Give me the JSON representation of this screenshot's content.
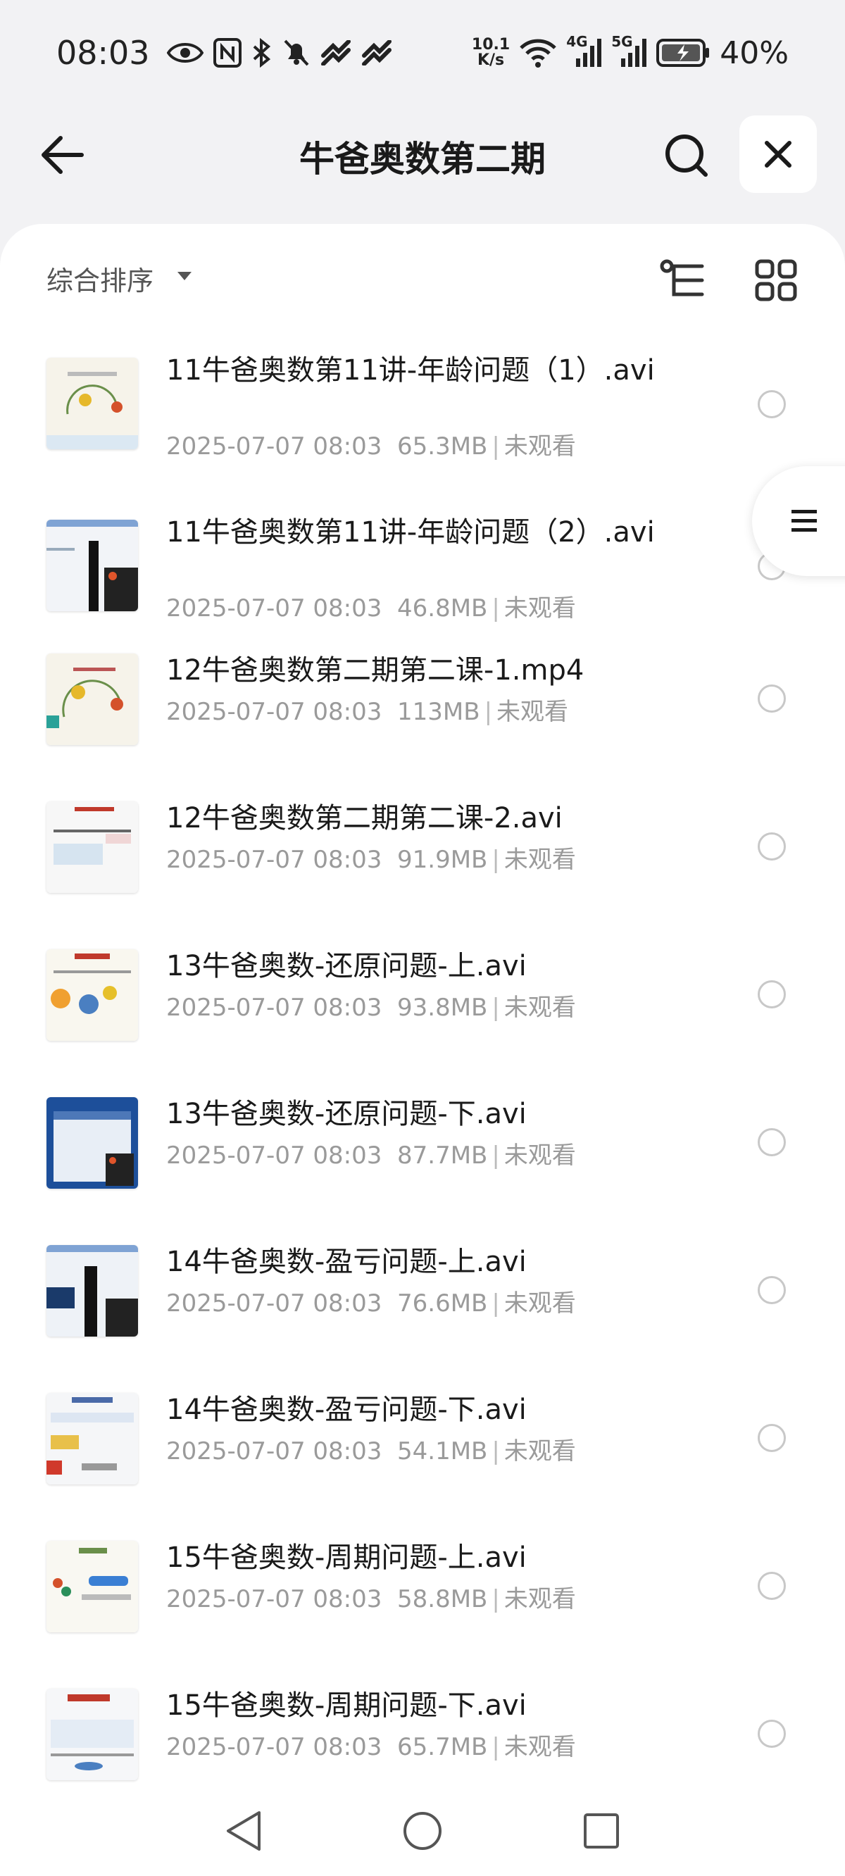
{
  "status_bar": {
    "time": "08:03",
    "net_speed_value": "10.1",
    "net_speed_unit": "K/s",
    "net_4g": "4G",
    "net_5g": "5G",
    "battery": "40%"
  },
  "header": {
    "title": "牛爸奥数第二期",
    "back_icon": "arrow-left-icon",
    "search_icon": "search-icon",
    "close_icon": "close-icon"
  },
  "toolbar": {
    "sort_label": "综合排序",
    "caret_icon": "caret-down-icon",
    "tree_icon": "tree-view-icon",
    "grid_icon": "grid-view-icon"
  },
  "files": [
    {
      "name": "11牛爸奥数第11讲-年龄问题（1）.avi",
      "date": "2025-07-07 08:03",
      "size": "65.3MB",
      "status": "未观看"
    },
    {
      "name": "11牛爸奥数第11讲-年龄问题（2）.avi",
      "date": "2025-07-07 08:03",
      "size": "46.8MB",
      "status": "未观看"
    },
    {
      "name": "12牛爸奥数第二期第二课-1.mp4",
      "date": "2025-07-07 08:03",
      "size": "113MB",
      "status": "未观看"
    },
    {
      "name": "12牛爸奥数第二期第二课-2.avi",
      "date": "2025-07-07 08:03",
      "size": "91.9MB",
      "status": "未观看"
    },
    {
      "name": "13牛爸奥数-还原问题-上.avi",
      "date": "2025-07-07 08:03",
      "size": "93.8MB",
      "status": "未观看"
    },
    {
      "name": "13牛爸奥数-还原问题-下.avi",
      "date": "2025-07-07 08:03",
      "size": "87.7MB",
      "status": "未观看"
    },
    {
      "name": "14牛爸奥数-盈亏问题-上.avi",
      "date": "2025-07-07 08:03",
      "size": "76.6MB",
      "status": "未观看"
    },
    {
      "name": "14牛爸奥数-盈亏问题-下.avi",
      "date": "2025-07-07 08:03",
      "size": "54.1MB",
      "status": "未观看"
    },
    {
      "name": "15牛爸奥数-周期问题-上.avi",
      "date": "2025-07-07 08:03",
      "size": "58.8MB",
      "status": "未观看"
    },
    {
      "name": "15牛爸奥数-周期问题-下.avi",
      "date": "2025-07-07 08:03",
      "size": "65.7MB",
      "status": "未观看"
    }
  ],
  "side_tab": {
    "icon": "list-index-icon"
  },
  "nav_bar": {
    "back": "nav-back-icon",
    "home": "nav-home-icon",
    "recents": "nav-recents-icon"
  }
}
